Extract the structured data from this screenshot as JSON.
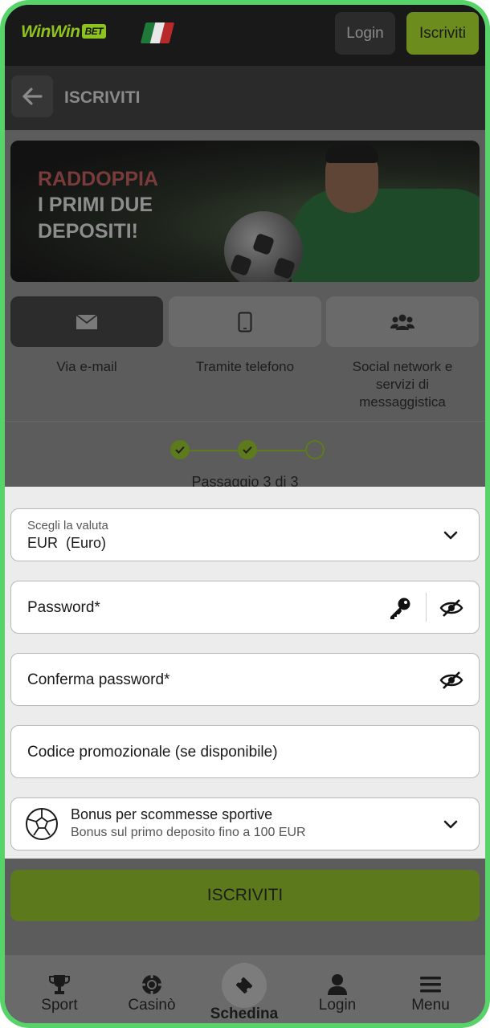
{
  "header": {
    "logo_text": "WinWin",
    "logo_badge": "BET",
    "login_label": "Login",
    "register_label": "Iscriviti",
    "flag_colors": [
      "#1f7a3a",
      "#e8e8e8",
      "#b82a2a"
    ]
  },
  "subheader": {
    "title": "ISCRIVITI",
    "back_icon": "arrow-left-icon"
  },
  "banner": {
    "line1": "RADDOPPIA",
    "line2": "I PRIMI DUE",
    "line3": "DEPOSITI!"
  },
  "registration_tabs": [
    {
      "label": "Via e-mail",
      "icon": "envelope-icon",
      "selected": true
    },
    {
      "label": "Tramite telefono",
      "icon": "phone-icon",
      "selected": false
    },
    {
      "label": "Social network e servizi di messaggistica",
      "icon": "users-icon",
      "selected": false
    }
  ],
  "stepper": {
    "completed_steps": 2,
    "total_steps": 3,
    "text": "Passaggio 3 di 3"
  },
  "form": {
    "currency": {
      "label": "Scegli la valuta",
      "value_code": "EUR",
      "value_name": "(Euro)"
    },
    "password": {
      "label": "Password*"
    },
    "confirm_password": {
      "label": "Conferma password*"
    },
    "promo_code": {
      "label": "Codice promozionale (se disponibile)"
    },
    "bonus": {
      "title": "Bonus per scommesse sportive",
      "subtitle": "Bonus sul primo deposito fino a 100 EUR"
    }
  },
  "submit_label": "ISCRIVITI",
  "bottom_nav": [
    {
      "label": "Sport",
      "icon": "trophy-icon"
    },
    {
      "label": "Casinò",
      "icon": "casino-chip-icon"
    },
    {
      "label": "Schedina",
      "icon": "ticket-icon"
    },
    {
      "label": "Login",
      "icon": "user-icon"
    },
    {
      "label": "Menu",
      "icon": "hamburger-menu-icon"
    }
  ],
  "colors": {
    "accent": "#8ec21f",
    "frame": "#58d36a"
  }
}
